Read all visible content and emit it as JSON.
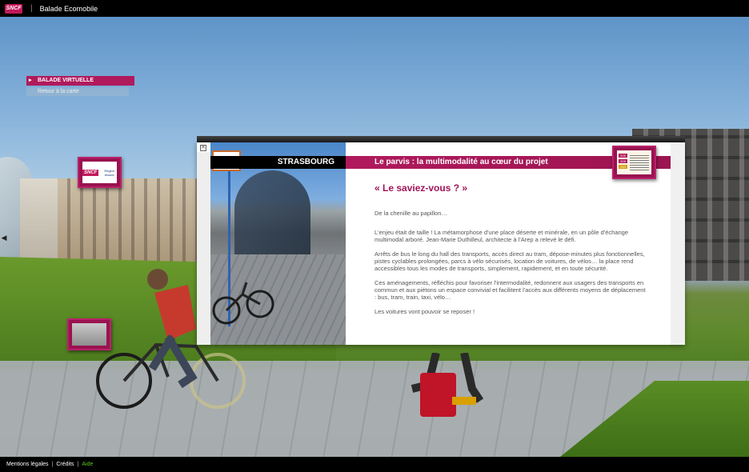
{
  "header": {
    "logo_text": "SNCF",
    "separator": "|",
    "app_title": "Balade Ecomobile"
  },
  "menu": {
    "active_label": "BALADE VIRTUELLE",
    "sub_label": "Retour à la carte"
  },
  "thumbnails": {
    "sncf_logo_text": "SNCF",
    "region_text": "Région Alsace"
  },
  "panel": {
    "close_symbol": "×",
    "city": "STRASBOURG",
    "title": "Le parvis : la multimodalité au cœur du projet",
    "heading": "« Le saviez-vous ? »",
    "paragraphs": [
      "De la chenille au papillon…",
      "L'enjeu était de taille ! La métamorphose d'une place déserte et minérale, en un pôle d'échange multimodal arboré. Jean-Marie Duthilleul, architecte à l'Arep a relevé le défi.",
      "Arrêts de bus le long du hall des transports, accès direct au tram, dépose-minutes plus fonctionnelles, pistes cyclables prolongées, parcs à vélo sécurisés, location de voitures, de vélos… la place rend accessibles tous les modes de transports, simplement, rapidement, et en toute sécurité.",
      "Ces aménagements, réfléchis pour favoriser l'intermodalité, redonnent aux usagers des transports en commun et aux piétons un espace convivial et facilitent l'accès aux différents moyens de déplacement : bus, tram, train, taxi, vélo…",
      "Les voitures vont pouvoir se reposer !"
    ],
    "doc_tags": [
      "205",
      "209",
      "210"
    ]
  },
  "footer": {
    "legal": "Mentions légales",
    "credits": "Crédits",
    "help": "Aide",
    "separator": "|"
  },
  "colors": {
    "brand": "#b01a5c",
    "heading": "#a2145a",
    "help_link": "#5ec62b"
  }
}
